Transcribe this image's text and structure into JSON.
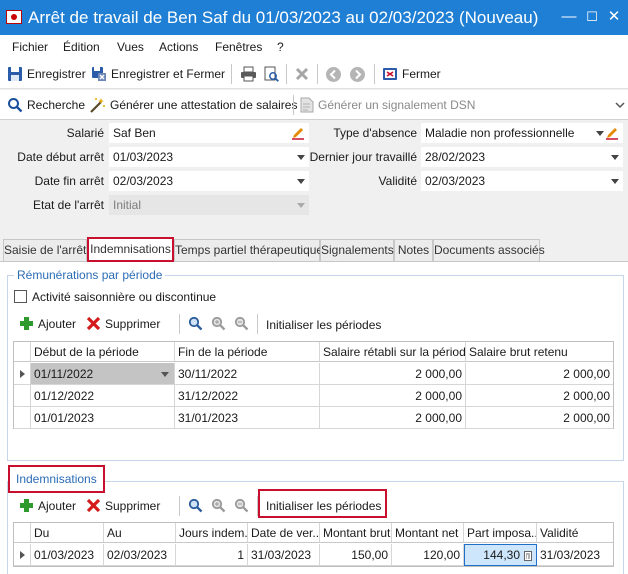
{
  "window": {
    "title": "Arrêt de travail de Ben Saf du 01/03/2023 au 02/03/2023 (Nouveau)",
    "minimize": "—",
    "maximize": "☐",
    "close": "✕"
  },
  "menu": [
    "Fichier",
    "Édition",
    "Vues",
    "Actions",
    "Fenêtres",
    "?"
  ],
  "toolbar1": {
    "save": "Enregistrer",
    "save_close": "Enregistrer et Fermer",
    "close": "Fermer"
  },
  "toolbar2": {
    "search": "Recherche",
    "attestation": "Générer une attestation de salaires",
    "dsn": "Générer un signalement DSN"
  },
  "form": {
    "salarie_label": "Salarié",
    "salarie_value": "Saf Ben",
    "debut_label": "Date début arrêt",
    "debut_value": "01/03/2023",
    "fin_label": "Date fin arrêt",
    "fin_value": "02/03/2023",
    "etat_label": "Etat de l'arrêt",
    "etat_value": "Initial",
    "type_label": "Type d'absence",
    "type_value": "Maladie non professionnelle",
    "dernier_label": "Dernier jour travaillé",
    "dernier_value": "28/02/2023",
    "validite_label": "Validité",
    "validite_value": "02/03/2023"
  },
  "tabs": [
    "Saisie de l'arrêt",
    "Indemnisations",
    "Temps partiel thérapeutique",
    "Signalements",
    "Notes",
    "Documents associés"
  ],
  "remunerations": {
    "title": "Rémunérations par période",
    "checkbox_label": "Activité saisonnière ou discontinue",
    "add": "Ajouter",
    "delete": "Supprimer",
    "init": "Initialiser les périodes",
    "columns": [
      "Début de la période",
      "Fin de la période",
      "Salaire rétabli sur la période",
      "Salaire brut retenu"
    ],
    "rows": [
      [
        "01/11/2022",
        "30/11/2022",
        "2 000,00",
        "2 000,00"
      ],
      [
        "01/12/2022",
        "31/12/2022",
        "2 000,00",
        "2 000,00"
      ],
      [
        "01/01/2023",
        "31/01/2023",
        "2 000,00",
        "2 000,00"
      ]
    ]
  },
  "indemnisations": {
    "title": "Indemnisations",
    "add": "Ajouter",
    "delete": "Supprimer",
    "init": "Initialiser les périodes",
    "columns": [
      "Du",
      "Au",
      "Jours indem...",
      "Date de ver...",
      "Montant brut",
      "Montant net",
      "Part imposa...",
      "Validité"
    ],
    "rows": [
      [
        "01/03/2023",
        "02/03/2023",
        "1",
        "31/03/2023",
        "150,00",
        "120,00",
        "144,30",
        "31/03/2023"
      ]
    ]
  },
  "colors": {
    "titlebar": "#1f7fd4",
    "accent_red": "#c8102e",
    "group_title": "#2b6cb5"
  }
}
